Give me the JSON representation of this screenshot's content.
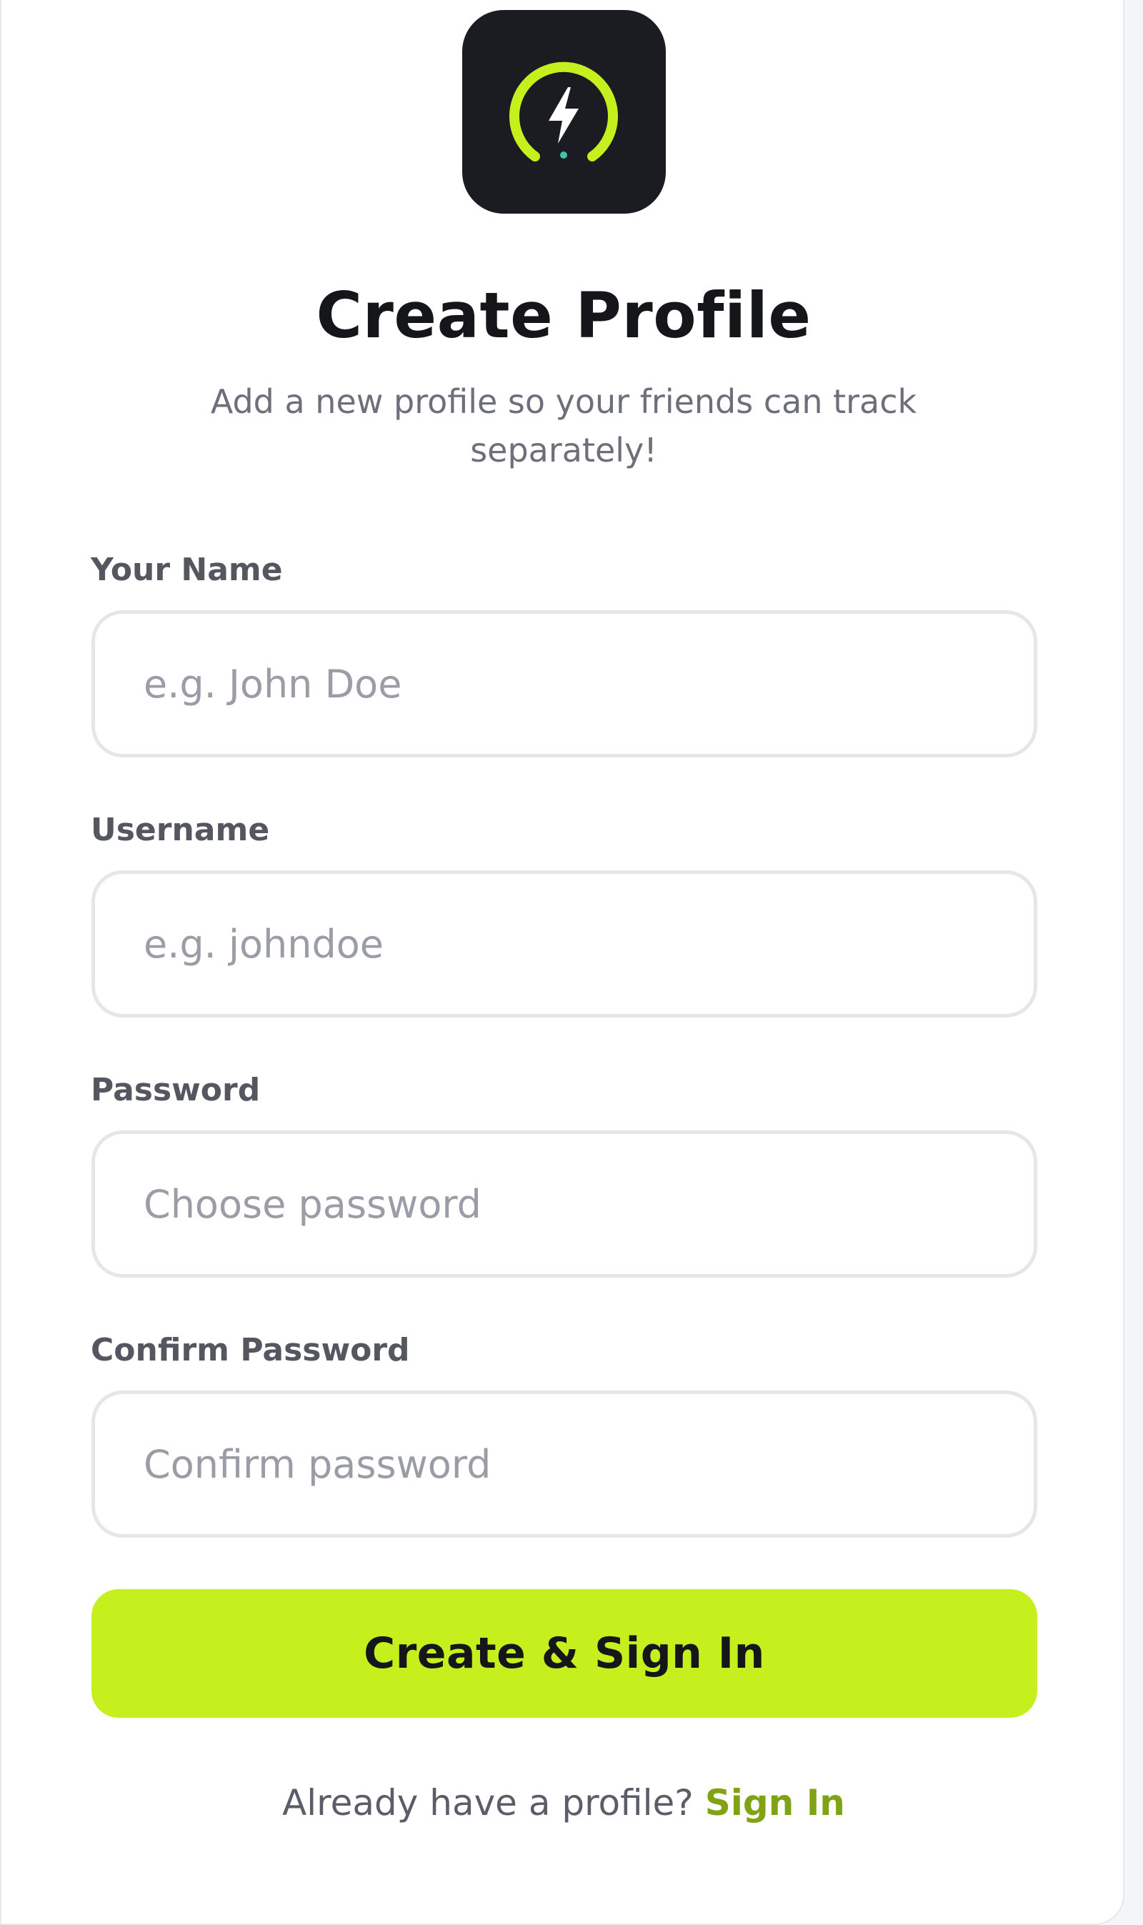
{
  "app": {
    "logo_icon": "lightning-gauge-icon",
    "accent_color": "#c6f01d",
    "link_color": "#7fa312"
  },
  "header": {
    "title": "Create Profile",
    "subtitle": "Add a new profile so your friends can track separately!"
  },
  "form": {
    "name": {
      "label": "Your Name",
      "placeholder": "e.g. John Doe",
      "value": ""
    },
    "username": {
      "label": "Username",
      "placeholder": "e.g. johndoe",
      "value": ""
    },
    "password": {
      "label": "Password",
      "placeholder": "Choose password",
      "value": ""
    },
    "confirm_password": {
      "label": "Confirm Password",
      "placeholder": "Confirm password",
      "value": ""
    },
    "submit_label": "Create & Sign In"
  },
  "footer": {
    "prompt": "Already have a profile?",
    "link_label": "Sign In"
  }
}
